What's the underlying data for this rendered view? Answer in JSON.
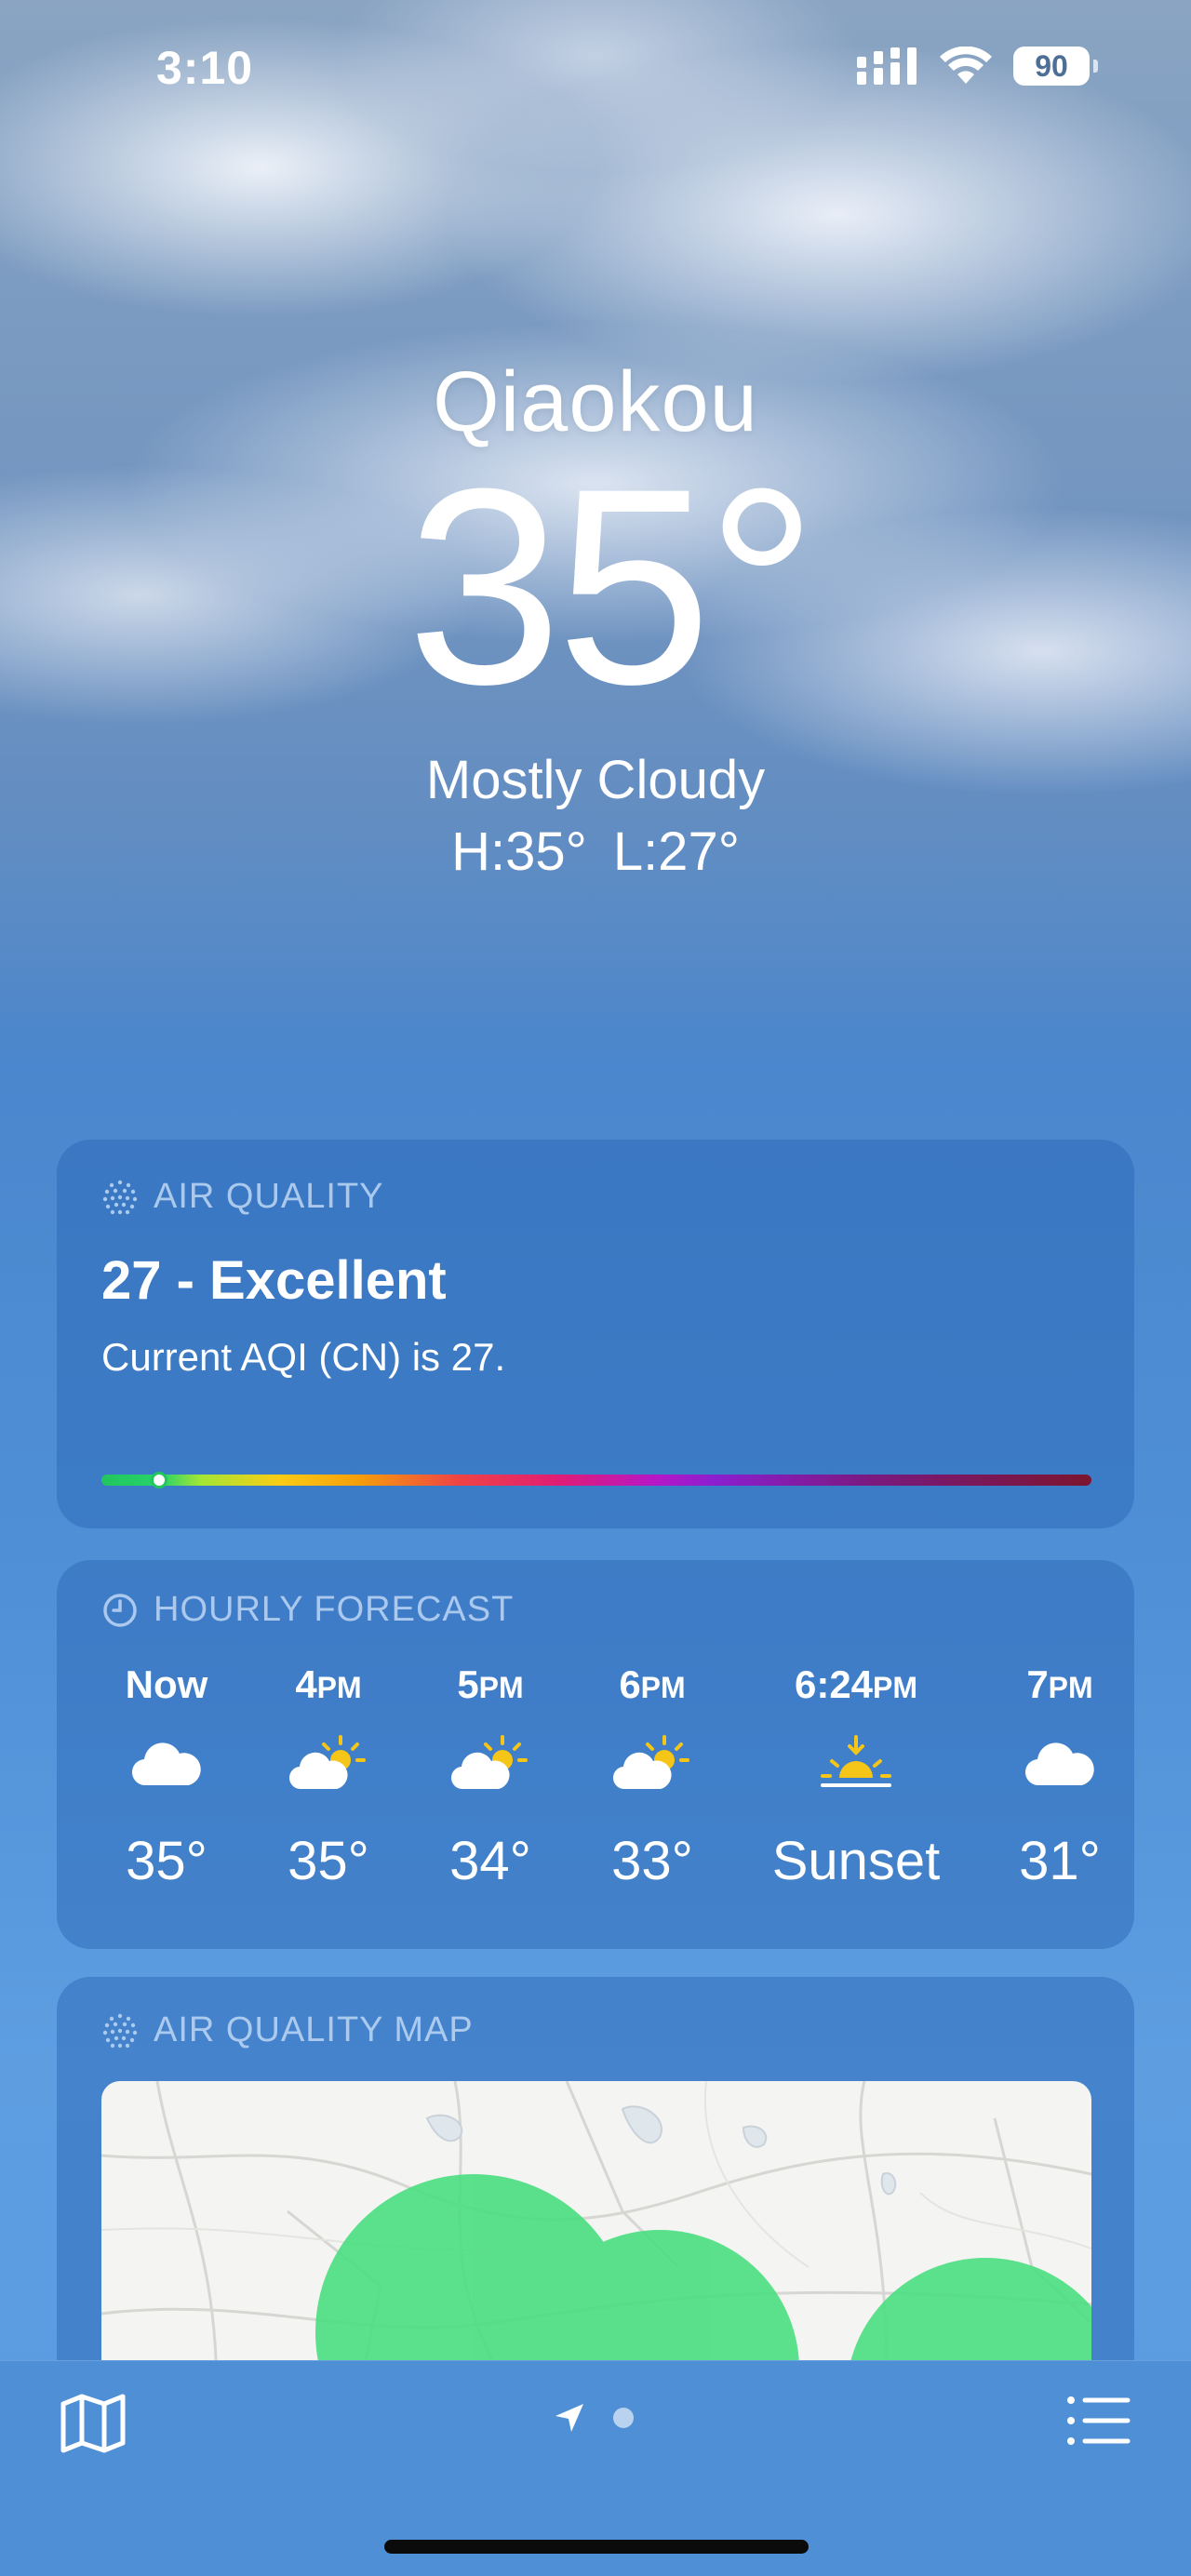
{
  "status_bar": {
    "time": "3:10",
    "battery": "90"
  },
  "header": {
    "city": "Qiaokou",
    "temperature": "35°",
    "condition": "Mostly Cloudy",
    "high": "H:35°",
    "low": "L:27°"
  },
  "air_quality": {
    "title": "AIR QUALITY",
    "value": "27 - Excellent",
    "description": "Current AQI (CN) is 27.",
    "level": 0.058
  },
  "hourly": {
    "title": "HOURLY FORECAST",
    "hours": [
      {
        "label": "Now",
        "suffix": "",
        "icon": "cloud-icon",
        "temp": "35°"
      },
      {
        "label": "4",
        "suffix": "PM",
        "icon": "partly-sunny-icon",
        "temp": "35°"
      },
      {
        "label": "5",
        "suffix": "PM",
        "icon": "partly-sunny-icon",
        "temp": "34°"
      },
      {
        "label": "6",
        "suffix": "PM",
        "icon": "partly-sunny-icon",
        "temp": "33°"
      },
      {
        "label": "6:24",
        "suffix": "PM",
        "icon": "sunset-icon",
        "temp": "Sunset"
      },
      {
        "label": "7",
        "suffix": "PM",
        "icon": "cloud-icon",
        "temp": "31°"
      }
    ]
  },
  "aq_map": {
    "title": "AIR QUALITY MAP"
  },
  "colors": {
    "aqi_excellent": "#4ade80",
    "sun": "#f5c518",
    "card_label": "#bed7f5"
  }
}
